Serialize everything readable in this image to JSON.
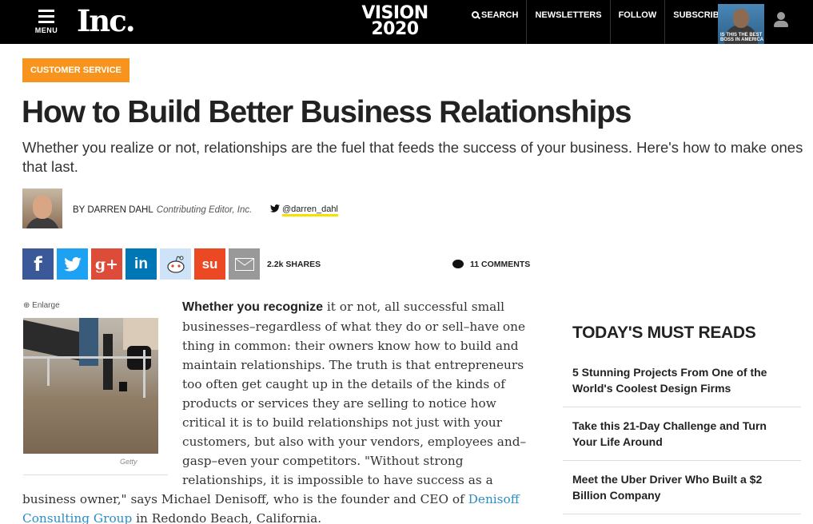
{
  "header": {
    "menu_label": "MENU",
    "logo": "Inc.",
    "vision_line1": "VISION",
    "vision_line2": "2020",
    "nav": [
      "SEARCH",
      "NEWSLETTERS",
      "FOLLOW",
      "SUBSCRIBE"
    ],
    "cover_text": "IS THIS THE BEST BOSS IN AMERICA"
  },
  "article": {
    "category": "CUSTOMER SERVICE",
    "title": "How to Build Better Business Relationships",
    "dek": "Whether you realize or not, relationships are the fuel that feeds the success of your business. Here's how to make ones that last.",
    "byline_prefix": "BY DARREN DAHL",
    "author_role": "Contributing Editor, Inc.",
    "twitter_handle": "@darren_dahl",
    "shares": "2.2k SHARES",
    "comments": "11 COMMENTS",
    "enlarge_label": "Enlarge",
    "photo_credit": "Getty",
    "lead_bold": "Whether you recognize",
    "body_part1": " it or not, all successful small businesses–regardless of what they do or sell–have one thing in common: their owners know how to build and maintain relationships. The truth is that entrepreneurs too often get caught up in the details of the kinds of products or services they are selling to notice how critical it is to build relationships not just with your customers, but also with your vendors, employees and–gasp–even your competitors. \"Without strong relationships, it is impossible to have success as a business owner,\" says Michael Denisoff, who is the founder and CEO of ",
    "link_text": "Denisoff Consulting Group",
    "body_part2": " in Redondo Beach, California."
  },
  "share_buttons": [
    {
      "icon": "facebook-icon",
      "glyph": "f",
      "color": "#3b5998"
    },
    {
      "icon": "twitter-icon",
      "glyph": "🐦",
      "color": "#1da1f2"
    },
    {
      "icon": "google-plus-icon",
      "glyph": "g+",
      "color": "#dd4b39"
    },
    {
      "icon": "linkedin-icon",
      "glyph": "in",
      "color": "#0077b5"
    },
    {
      "icon": "reddit-icon",
      "glyph": "●",
      "color": "#cee3f8"
    },
    {
      "icon": "stumbleupon-icon",
      "glyph": "su",
      "color": "#eb4924"
    },
    {
      "icon": "email-icon",
      "glyph": "✉",
      "color": "#999999"
    }
  ],
  "sidebar": {
    "title": "TODAY'S MUST READS",
    "items": [
      "5 Stunning Projects From One of the World's Coolest Design Firms",
      "Take this 21-Day Challenge and Turn Your Life Around",
      "Meet the Uber Driver Who Built a $2 Billion Company"
    ]
  }
}
